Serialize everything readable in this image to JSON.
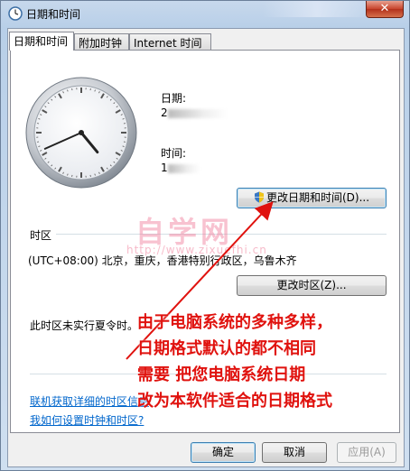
{
  "window": {
    "title": "日期和时间",
    "close_glyph": "✕"
  },
  "tabs": [
    {
      "label": "日期和时间",
      "active": true
    },
    {
      "label": "附加时钟",
      "active": false
    },
    {
      "label": "Internet 时间",
      "active": false
    }
  ],
  "datetime": {
    "date_label": "日期:",
    "date_value": "2",
    "time_label": "时间:",
    "time_value": "1",
    "change_button": "更改日期和时间(D)..."
  },
  "timezone": {
    "section_label": "时区",
    "value": "(UTC+08:00) 北京，重庆，香港特别行政区，乌鲁木齐",
    "change_button": "更改时区(Z)...",
    "dst_note": "此时区未实行夏令时。"
  },
  "links": {
    "online_info": "联机获取详细的时区信息",
    "how_to_set": "我如何设置时钟和时区?"
  },
  "footer": {
    "ok": "确定",
    "cancel": "取消",
    "apply": "应用(A)"
  },
  "watermark": {
    "text": "自学网",
    "url": "http://www.zixuefhi.cn"
  },
  "annotation": {
    "lines": [
      "由于电脑系统的多种多样，",
      "日期格式默认的都不相同",
      "需要 把您电脑系统日期",
      "改为本软件适合的日期格式"
    ],
    "color": "#e0120e"
  },
  "clock": {
    "hour": 4,
    "minute": 41
  }
}
